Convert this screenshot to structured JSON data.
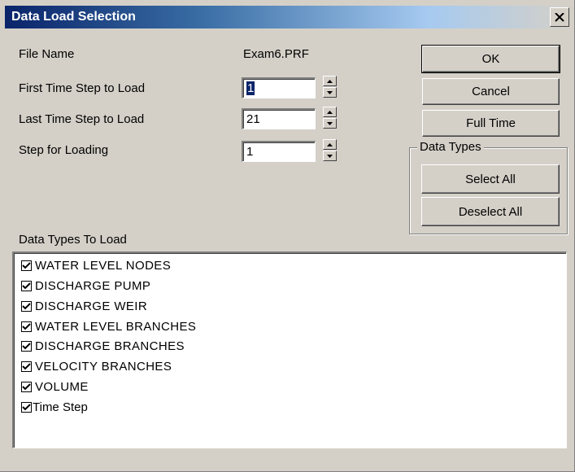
{
  "window": {
    "title": "Data Load Selection"
  },
  "file": {
    "label": "File Name",
    "value": "Exam6.PRF"
  },
  "fields": {
    "first": {
      "label": "First Time Step to Load",
      "value": "1"
    },
    "last": {
      "label": "Last Time Step to Load",
      "value": "21"
    },
    "step": {
      "label": "Step for Loading",
      "value": "1"
    }
  },
  "buttons": {
    "ok": "OK",
    "cancel": "Cancel",
    "full_time": "Full Time",
    "select_all": "Select All",
    "deselect_all": "Deselect All"
  },
  "groupbox": {
    "title": "Data Types"
  },
  "list": {
    "label": "Data Types To Load",
    "items": [
      {
        "label": "WATER LEVEL  NODES",
        "checked": true
      },
      {
        "label": "DISCHARGE  PUMP",
        "checked": true
      },
      {
        "label": "DISCHARGE  WEIR",
        "checked": true
      },
      {
        "label": "WATER LEVEL  BRANCHES",
        "checked": true
      },
      {
        "label": "DISCHARGE  BRANCHES",
        "checked": true
      },
      {
        "label": "VELOCITY  BRANCHES",
        "checked": true
      },
      {
        "label": "VOLUME",
        "checked": true
      },
      {
        "label": "Time Step",
        "checked": true
      }
    ]
  },
  "icons": {
    "close": "close-icon",
    "spin_up": "arrow-up-icon",
    "spin_down": "arrow-down-icon",
    "check": "checkmark-icon"
  }
}
